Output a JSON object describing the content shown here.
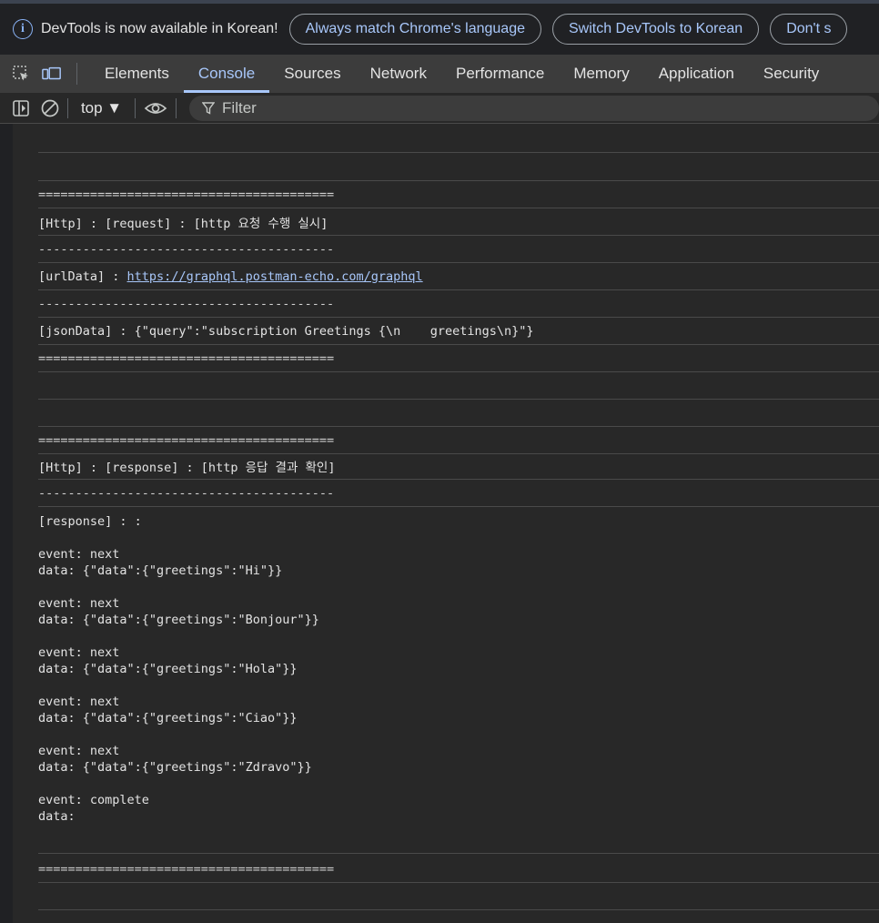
{
  "infobar": {
    "message": "DevTools is now available in Korean!",
    "buttons": [
      "Always match Chrome's language",
      "Switch DevTools to Korean",
      "Don't s"
    ]
  },
  "tabs": [
    "Elements",
    "Console",
    "Sources",
    "Network",
    "Performance",
    "Memory",
    "Application",
    "Security"
  ],
  "active_tab": "Console",
  "toolbar": {
    "context": "top ▼",
    "filter_placeholder": "Filter"
  },
  "console": {
    "sep_eq": "========================================",
    "sep_dash": "----------------------------------------",
    "req_line": "[Http] : [request] : [http 요청 수행 실시]",
    "url_label": "[urlData] : ",
    "url_link": "https://graphql.postman-echo.com/graphql",
    "json_line": "[jsonData] : {\"query\":\"subscription Greetings {\\n    greetings\\n}\"}",
    "resp_line": "[Http] : [response] : [http 응답 결과 확인]",
    "response_body": "[response] : :\n\nevent: next\ndata: {\"data\":{\"greetings\":\"Hi\"}}\n\nevent: next\ndata: {\"data\":{\"greetings\":\"Bonjour\"}}\n\nevent: next\ndata: {\"data\":{\"greetings\":\"Hola\"}}\n\nevent: next\ndata: {\"data\":{\"greetings\":\"Ciao\"}}\n\nevent: next\ndata: {\"data\":{\"greetings\":\"Zdravo\"}}\n\nevent: complete\ndata:"
  }
}
